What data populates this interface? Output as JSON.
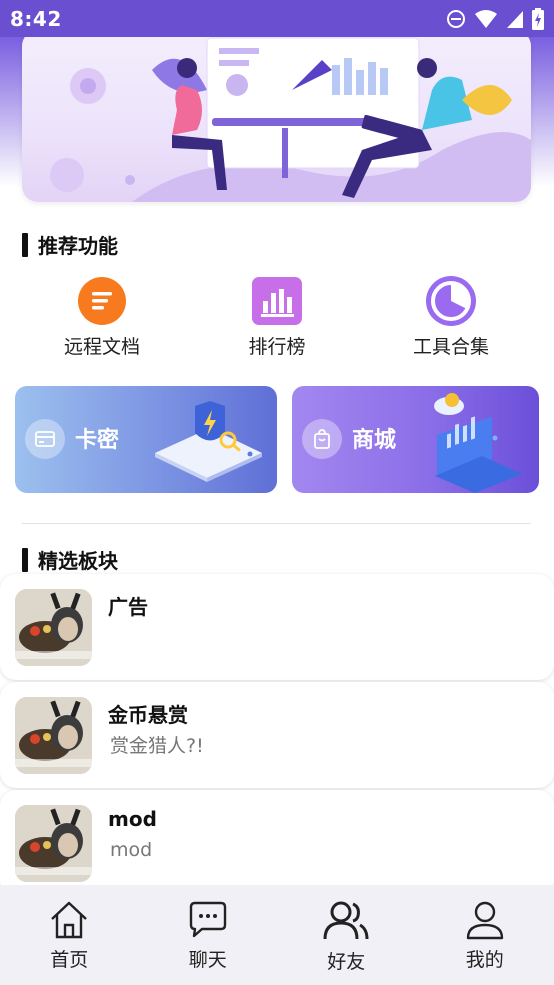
{
  "status_bar": {
    "time": "8:42",
    "icons": [
      "dnd-icon",
      "wifi-icon",
      "signal-icon",
      "battery-icon"
    ]
  },
  "banner": {
    "description_icon": "illustration-icon"
  },
  "recommended": {
    "title": "推荐功能",
    "features": [
      {
        "label": "远程文档",
        "icon": "document-icon",
        "color": "#f77b1e"
      },
      {
        "label": "排行榜",
        "icon": "chart-icon",
        "color": "#c66fe8"
      },
      {
        "label": "工具合集",
        "icon": "pie-icon",
        "color": "#9a6af0"
      }
    ]
  },
  "cards": [
    {
      "label": "卡密",
      "icon": "card-icon"
    },
    {
      "label": "商城",
      "icon": "shop-bag-icon"
    }
  ],
  "featured": {
    "title": "精选板块",
    "boards": [
      {
        "title": "广告",
        "subtitle": ""
      },
      {
        "title": "金币悬赏",
        "subtitle": "赏金猎人?!"
      },
      {
        "title": "mod",
        "subtitle": "mod"
      }
    ]
  },
  "tabbar": {
    "tabs": [
      {
        "label": "首页",
        "icon": "home-icon"
      },
      {
        "label": "聊天",
        "icon": "chat-icon"
      },
      {
        "label": "好友",
        "icon": "friends-icon"
      },
      {
        "label": "我的",
        "icon": "profile-icon"
      }
    ]
  },
  "colors": {
    "accent": "#6a4fd1",
    "orange": "#f77b1e",
    "pink_purple": "#c66fe8",
    "purple": "#9a6af0"
  }
}
